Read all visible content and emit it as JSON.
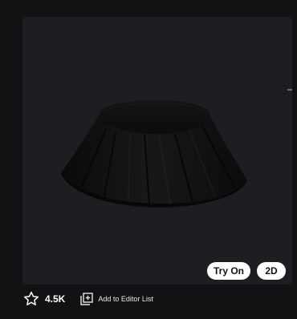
{
  "item_preview": {
    "buttons": {
      "try_on_label": "Try On",
      "view_2d_label": "2D"
    }
  },
  "actions": {
    "favorite_count": "4.5K",
    "add_to_editor_label": "Add to Editor List"
  },
  "icons": {
    "favorite": "star-outline-icon",
    "add_to_list": "add-to-list-icon"
  },
  "colors": {
    "page_background": "#111214",
    "preview_background": "#1d1e21",
    "button_background": "#ffffff",
    "button_text": "#111214"
  }
}
